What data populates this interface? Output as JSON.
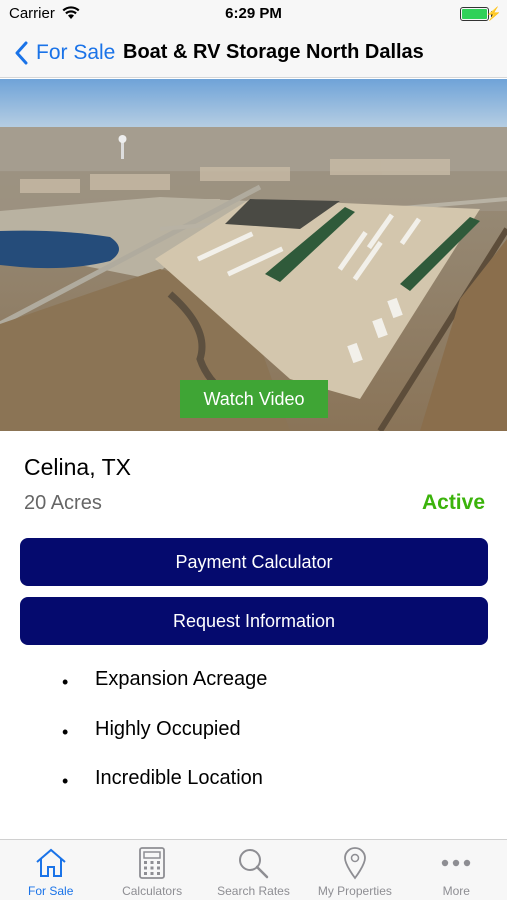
{
  "status_bar": {
    "carrier": "Carrier",
    "time": "6:29 PM",
    "battery_level": 1.0,
    "charging_glyph": "⚡"
  },
  "nav": {
    "back_label": "For Sale",
    "title": "Boat & RV Storage North Dallas"
  },
  "hero": {
    "watch_video_label": "Watch Video"
  },
  "property": {
    "location": "Celina, TX",
    "acres": "20 Acres",
    "status": "Active",
    "status_color": "#3bb30b"
  },
  "actions": {
    "payment_calculator": "Payment Calculator",
    "request_information": "Request Information",
    "button_color": "#050a6e"
  },
  "features": [
    {
      "bullet": "•",
      "text": "Expansion Acreage"
    },
    {
      "bullet": "•",
      "text": "Highly Occupied"
    },
    {
      "bullet": "•",
      "text": "Incredible Location"
    }
  ],
  "tab_bar": {
    "active_color": "#1a73e8",
    "tabs": [
      {
        "label": "For Sale",
        "icon": "home-icon",
        "active": true
      },
      {
        "label": "Calculators",
        "icon": "calculator-icon",
        "active": false
      },
      {
        "label": "Search Rates",
        "icon": "search-icon",
        "active": false
      },
      {
        "label": "My Properties",
        "icon": "map-pin-icon",
        "active": false
      },
      {
        "label": "More",
        "icon": "more-dots-icon",
        "active": false
      }
    ]
  }
}
